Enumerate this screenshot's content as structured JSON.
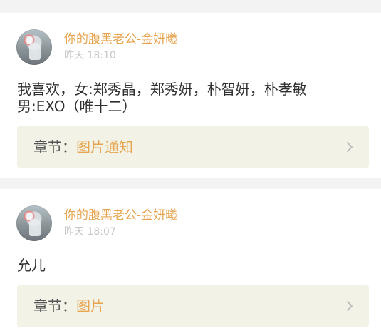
{
  "colors": {
    "background": "#f3f3f3",
    "card": "#ffffff",
    "username": "#e7a44f",
    "time": "#c7c7c7",
    "text": "#2f2f2f",
    "chapter_bg": "#f2f3e6",
    "chapter_label": "#555555",
    "chevron": "#bdbdbd"
  },
  "posts": [
    {
      "username": "你的腹黑老公-金妍曦",
      "time": "昨天 18:10",
      "content_lines": [
        "我喜欢，女:郑秀晶，郑秀妍，朴智妍，朴孝敏",
        "男:EXO（唯十二）"
      ],
      "chapter_prefix": "章节：",
      "chapter_title": "图片通知",
      "icons": {
        "avatar": "avatar",
        "chevron": "chevron-right-icon"
      }
    },
    {
      "username": "你的腹黑老公-金妍曦",
      "time": "昨天 18:07",
      "content_lines": [
        "允儿"
      ],
      "chapter_prefix": "章节：",
      "chapter_title": "图片",
      "icons": {
        "avatar": "avatar",
        "chevron": "chevron-right-icon"
      }
    }
  ]
}
